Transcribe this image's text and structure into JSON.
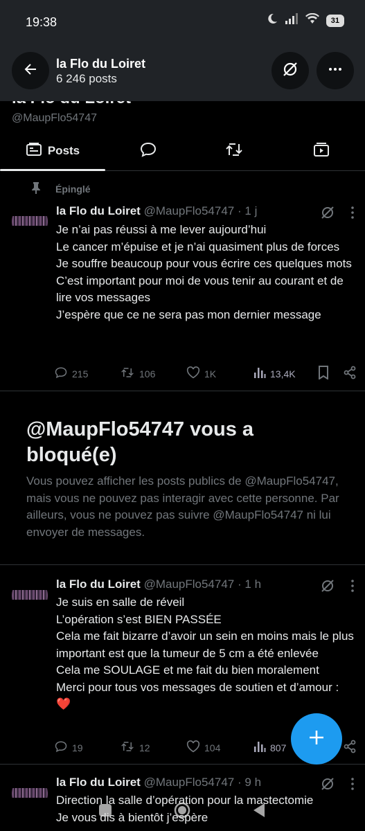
{
  "status_bar": {
    "time": "19:38",
    "battery": "31"
  },
  "header": {
    "title": "la Flo du Loiret",
    "subtitle": "6 246 posts",
    "back_icon": "arrow-left-icon",
    "grok_icon": "grok-slash-icon",
    "more_icon": "more-dots-icon"
  },
  "profile": {
    "name": "la Flo du Loiret",
    "handle": "@MaupFlo54747"
  },
  "tabs": [
    {
      "label": "Posts",
      "icon": "posts-icon",
      "active": true
    },
    {
      "label": "",
      "icon": "reply-bubble-icon"
    },
    {
      "label": "",
      "icon": "repost-icon"
    },
    {
      "label": "",
      "icon": "media-icon"
    }
  ],
  "pinned_label": "Épinglé",
  "tweets": [
    {
      "name": "la Flo du Loiret",
      "handle": "@MaupFlo54747",
      "time": "1 j",
      "lines": [
        "Je n’ai pas réussi à me lever aujourd’hui",
        "Le cancer m’épuise et je n’ai quasiment plus de forces",
        "Je souffre beaucoup pour vous écrire ces quelques mots",
        "C’est important pour moi de vous tenir au courant et de lire vos messages",
        "J’espère que ce ne sera pas mon dernier message"
      ],
      "replies": "215",
      "reposts": "106",
      "likes": "1K",
      "views": "13,4K"
    },
    {
      "name": "la Flo du Loiret",
      "handle": "@MaupFlo54747",
      "time": "1 h",
      "lines": [
        "Je suis en salle de réveil",
        "L’opération s’est BIEN PASSÉE",
        "Cela me fait bizarre d’avoir un sein en moins mais le plus important est que la tumeur de 5 cm a été enlevée",
        "Cela me SOULAGE et me fait du bien moralement",
        "Merci pour tous vos messages de soutien et d’amour : ❤️"
      ],
      "replies": "19",
      "reposts": "12",
      "likes": "104",
      "views": "807"
    },
    {
      "name": "la Flo du Loiret",
      "handle": "@MaupFlo54747",
      "time": "9 h",
      "lines": [
        "Direction la salle d’opération pour la mastectomie",
        "Je vous dis à bientôt j’espère"
      ]
    }
  ],
  "blocked": {
    "title": "@MaupFlo54747 vous a bloqué(e)",
    "text": "Vous pouvez afficher les posts publics de @MaupFlo54747, mais vous ne pouvez pas interagir avec cette personne. Par ailleurs, vous ne pouvez pas suivre @MaupFlo54747 ni lui envoyer de messages."
  },
  "fab_icon": "plus-compose-icon",
  "colors": {
    "accent": "#1d9bf0",
    "background": "#000000",
    "muted": "#71767b",
    "heart": "#f91880"
  }
}
